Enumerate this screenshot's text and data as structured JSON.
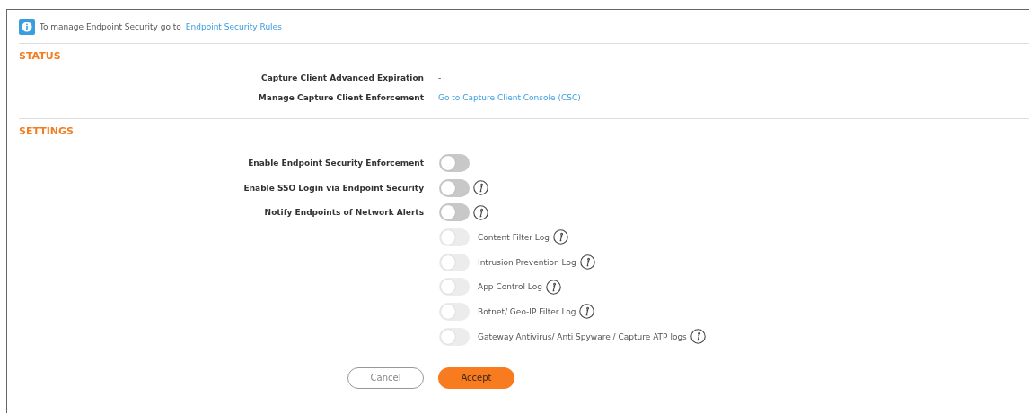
{
  "notice": {
    "text": "To manage Endpoint Security go to",
    "link": "Endpoint Security Rules"
  },
  "status": {
    "heading": "STATUS",
    "rows": [
      {
        "label": "Capture Client Advanced Expiration",
        "kind": "text",
        "value": "-"
      },
      {
        "label": "Manage Capture Client Enforcement",
        "kind": "link",
        "value": "Go to Capture Client Console (CSC)"
      }
    ]
  },
  "settings": {
    "heading": "SETTINGS",
    "rows": [
      {
        "kind": "main",
        "label": "Enable Endpoint Security Enforcement",
        "on": false,
        "disabled": false,
        "info": false
      },
      {
        "kind": "main",
        "label": "Enable SSO Login via Endpoint Security",
        "on": false,
        "disabled": false,
        "info": true
      },
      {
        "kind": "main",
        "label": "Notify Endpoints of Network Alerts",
        "on": false,
        "disabled": false,
        "info": true
      },
      {
        "kind": "sub",
        "label": "Content Filter Log",
        "on": false,
        "disabled": true,
        "info": true
      },
      {
        "kind": "sub",
        "label": "Intrusion Prevention Log",
        "on": false,
        "disabled": true,
        "info": true
      },
      {
        "kind": "sub",
        "label": "App Control Log",
        "on": false,
        "disabled": true,
        "info": true
      },
      {
        "kind": "sub",
        "label": "Botnet/ Geo-IP Filter Log",
        "on": false,
        "disabled": true,
        "info": true
      },
      {
        "kind": "sub",
        "label": "Gateway Antivirus/ Anti Spyware / Capture ATP logs",
        "on": false,
        "disabled": true,
        "info": true
      }
    ]
  },
  "buttons": {
    "cancel": "Cancel",
    "accept": "Accept"
  }
}
